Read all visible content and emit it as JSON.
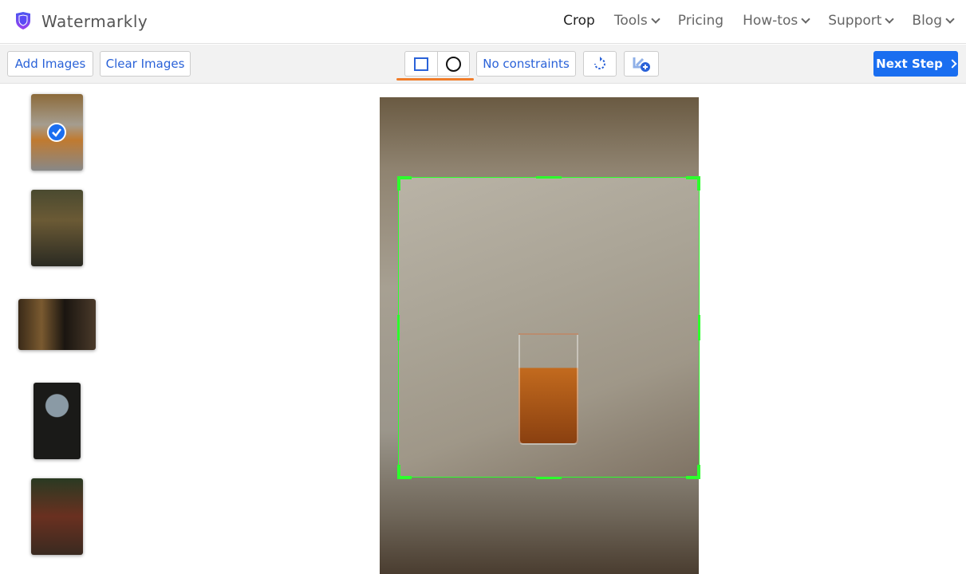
{
  "header": {
    "brand": "Watermarkly",
    "nav": [
      {
        "label": "Crop",
        "active": true
      },
      {
        "label": "Tools",
        "dropdown": true
      },
      {
        "label": "Pricing"
      },
      {
        "label": "How-tos",
        "dropdown": true
      },
      {
        "label": "Support",
        "dropdown": true
      },
      {
        "label": "Blog",
        "dropdown": true
      }
    ]
  },
  "toolbar": {
    "add_images": "Add Images",
    "clear_images": "Clear Images",
    "shape_selected": "rectangle",
    "constraints": "No constraints",
    "next_step": "Next Step"
  },
  "colors": {
    "accent": "#1a6ef0",
    "crop_frame": "#2cff2c",
    "shape_underline": "#f07d2a",
    "brand_shield": "#6a3ff0"
  },
  "thumbnails": [
    {
      "selected": true
    },
    {
      "selected": false
    },
    {
      "selected": false
    },
    {
      "selected": false
    },
    {
      "selected": false
    }
  ]
}
